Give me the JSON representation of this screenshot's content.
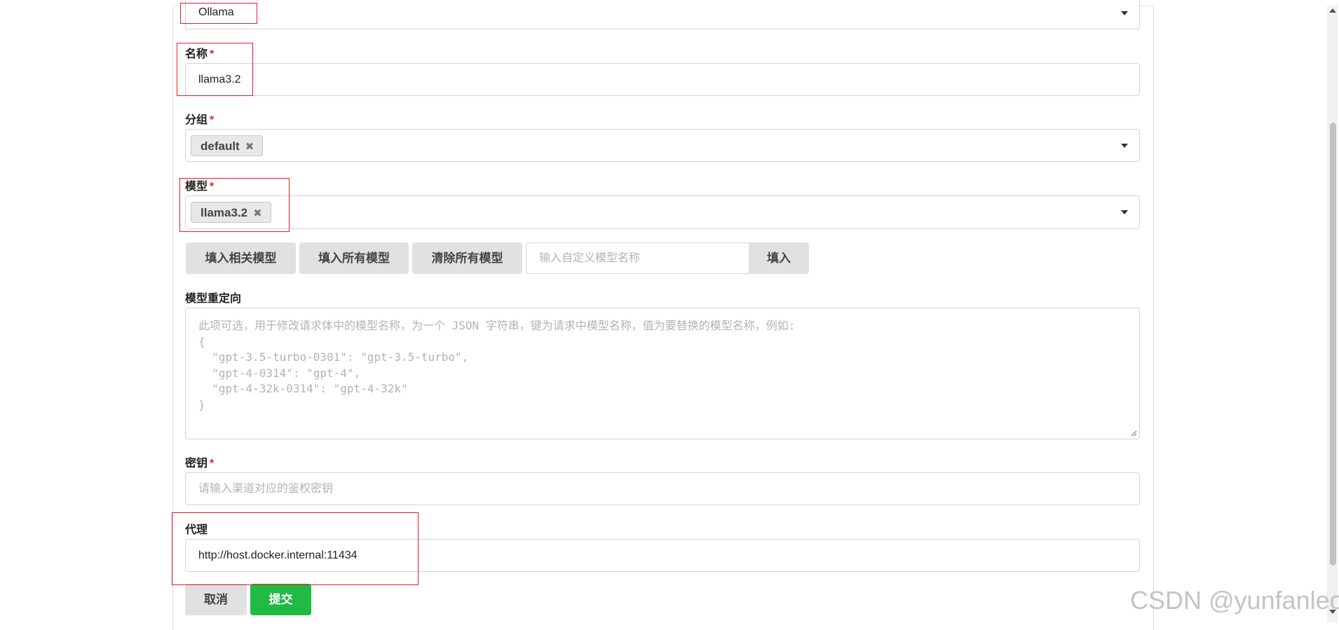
{
  "type_select": {
    "value": "Ollama"
  },
  "name_field": {
    "label": "名称",
    "required": "*",
    "value": "llama3.2"
  },
  "group_field": {
    "label": "分组",
    "required": "*",
    "chips": [
      {
        "label": "default",
        "remove": "✖"
      }
    ]
  },
  "model_field": {
    "label": "模型",
    "required": "*",
    "chips": [
      {
        "label": "llama3.2",
        "remove": "✖"
      }
    ]
  },
  "model_actions": {
    "fill_related": "填入相关模型",
    "fill_all": "填入所有模型",
    "clear_all": "清除所有模型",
    "custom_placeholder": "输入自定义模型名称",
    "fill": "填入"
  },
  "model_mapping": {
    "label": "模型重定向",
    "placeholder": "此项可选，用于修改请求体中的模型名称，为一个 JSON 字符串，键为请求中模型名称，值为要替换的模型名称，例如:\n{\n  \"gpt-3.5-turbo-0301\": \"gpt-3.5-turbo\",\n  \"gpt-4-0314\": \"gpt-4\",\n  \"gpt-4-32k-0314\": \"gpt-4-32k\"\n}"
  },
  "key_field": {
    "label": "密钥",
    "required": "*",
    "placeholder": "请输入渠道对应的鉴权密钥"
  },
  "proxy_field": {
    "label": "代理",
    "value": "http://host.docker.internal:11434"
  },
  "footer": {
    "cancel": "取消",
    "submit": "提交"
  },
  "watermark": "CSDN @yunfanleo",
  "colors": {
    "submit": "#21ba45",
    "highlight": "#e81c25",
    "required": "#db2828"
  },
  "icons": {
    "dropdown": "caret-down-icon",
    "chip_remove": "close-icon",
    "resize": "resize-grip-icon"
  }
}
